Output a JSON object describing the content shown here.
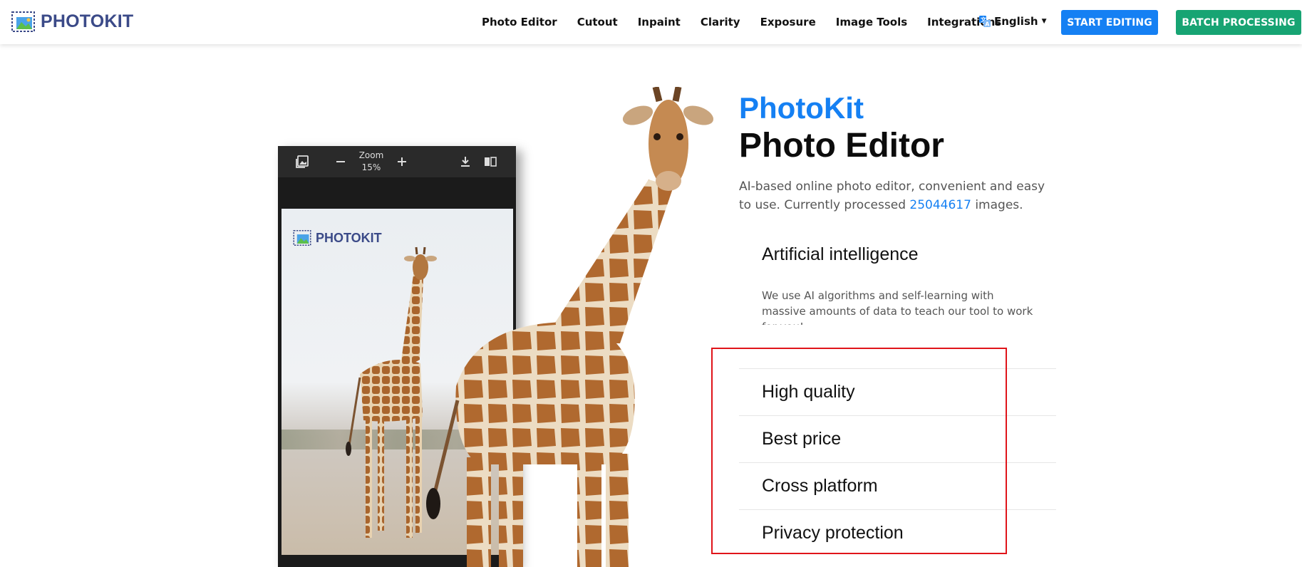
{
  "header": {
    "logo_text": "PHOTOKIT",
    "nav": [
      "Photo Editor",
      "Cutout",
      "Inpaint",
      "Clarity",
      "Exposure",
      "Image Tools",
      "Integrations"
    ],
    "language": "English",
    "start_button": "START EDITING",
    "batch_button": "BATCH PROCESSING"
  },
  "mockup": {
    "zoom_label": "Zoom",
    "zoom_value": "15%",
    "logo_text": "PHOTOKIT",
    "icons": [
      "image-icon",
      "minus-icon",
      "plus-icon",
      "download-icon",
      "compare-icon"
    ]
  },
  "hero": {
    "brand": "PhotoKit",
    "title": "Photo Editor",
    "desc_before": "AI-based online photo editor, convenient and easy to use. Currently processed ",
    "count": "25044617",
    "desc_after": " images."
  },
  "features": {
    "expanded": {
      "title": "Artificial intelligence",
      "body": "We use AI algorithms and self-learning with massive amounts of data to teach our tool to work for you!"
    },
    "items": [
      "High quality",
      "Best price",
      "Cross platform",
      "Privacy protection"
    ]
  },
  "colors": {
    "accent": "#1580f3",
    "batch": "#17a473",
    "logo": "#3b4a88",
    "highlight": "#e0141a"
  }
}
